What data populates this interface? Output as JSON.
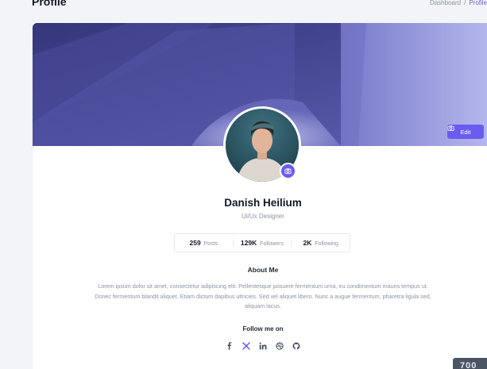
{
  "header": {
    "title": "Profile",
    "breadcrumb": {
      "home": "Dashboard",
      "separator": "/",
      "current": "Profile"
    }
  },
  "cover": {
    "edit_label": "Edit",
    "edit_icon": "camera-icon"
  },
  "profile": {
    "name": "Danish Heilium",
    "role": "Ui/Ux Designer",
    "avatar_icon": "camera-icon"
  },
  "stats": [
    {
      "value": "259",
      "label": "Posts"
    },
    {
      "value": "129K",
      "label": "Followers"
    },
    {
      "value": "2K",
      "label": "Following"
    }
  ],
  "about": {
    "title": "About Me",
    "text": "Lorem ipsum dolor sit amet, consectetur adipiscing elit. Pellentesque posuere fermentum urna, eu condimentum mauris tempus ut. Donec fermentum blandit aliquet. Etiam dictum dapibus ultricies. Sed vel aliquet libero. Nunc a augue fermentum, pharetra ligula sed, aliquam lacus."
  },
  "follow": {
    "title": "Follow me on",
    "icons": [
      "facebook-icon",
      "x-icon",
      "linkedin-icon",
      "dribbble-icon",
      "github-icon"
    ]
  },
  "corner_badge": "700",
  "colors": {
    "accent": "#6b5cf1",
    "breadcrumb_active": "#6a63d8",
    "x_icon": "#5b4ff0"
  }
}
